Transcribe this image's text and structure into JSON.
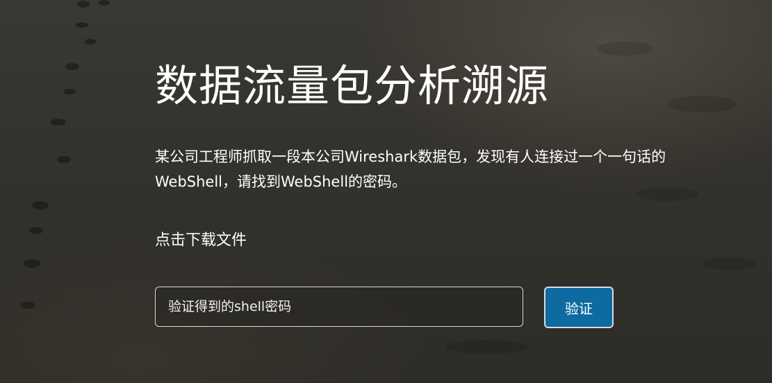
{
  "page": {
    "title": "数据流量包分析溯源",
    "description": "某公司工程师抓取一段本公司Wireshark数据包，发现有人连接过一个一句话的WebShell，请找到WebShell的密码。",
    "download_link": "点击下载文件"
  },
  "form": {
    "input_placeholder": "验证得到的shell密码",
    "input_value": "",
    "submit_label": "验证"
  },
  "colors": {
    "button_bg": "#0e6aa0",
    "text": "#ffffff",
    "background": "#34322d"
  }
}
